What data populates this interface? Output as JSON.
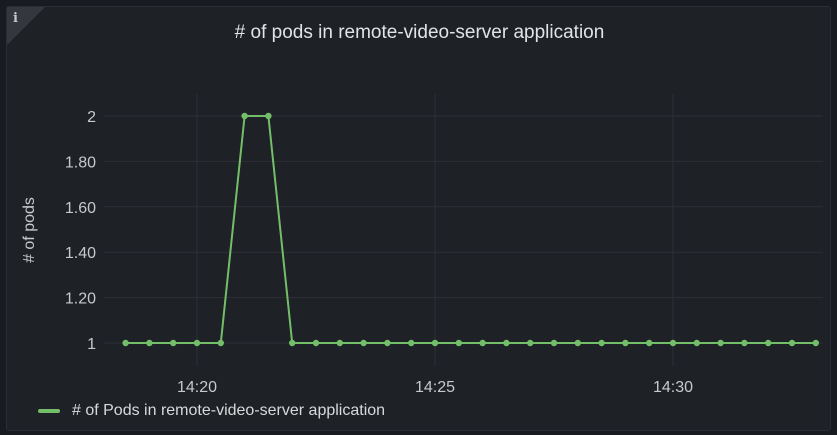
{
  "panel": {
    "info_icon": "info-icon",
    "title": "# of pods in remote-video-server application"
  },
  "chart_data": {
    "type": "line",
    "title": "# of pods in remote-video-server application",
    "xlabel": "",
    "ylabel": "# of pods",
    "x_tick_labels": [
      "14:20",
      "14:25",
      "14:30"
    ],
    "y_tick_labels": [
      "1",
      "1.20",
      "1.40",
      "1.60",
      "1.80",
      "2"
    ],
    "ylim": [
      1,
      2
    ],
    "grid": true,
    "legend_position": "bottom-left",
    "series": [
      {
        "name": "# of Pods in remote-video-server application",
        "color": "#73bf69",
        "x": [
          "14:18:30",
          "14:19:00",
          "14:19:30",
          "14:20:00",
          "14:20:30",
          "14:21:00",
          "14:21:30",
          "14:22:00",
          "14:22:30",
          "14:23:00",
          "14:23:30",
          "14:24:00",
          "14:24:30",
          "14:25:00",
          "14:25:30",
          "14:26:00",
          "14:26:30",
          "14:27:00",
          "14:27:30",
          "14:28:00",
          "14:28:30",
          "14:29:00",
          "14:29:30",
          "14:30:00",
          "14:30:30",
          "14:31:00",
          "14:31:30",
          "14:32:00",
          "14:32:30",
          "14:33:00"
        ],
        "values": [
          1,
          1,
          1,
          1,
          1,
          2,
          2,
          1,
          1,
          1,
          1,
          1,
          1,
          1,
          1,
          1,
          1,
          1,
          1,
          1,
          1,
          1,
          1,
          1,
          1,
          1,
          1,
          1,
          1,
          1
        ]
      }
    ]
  }
}
